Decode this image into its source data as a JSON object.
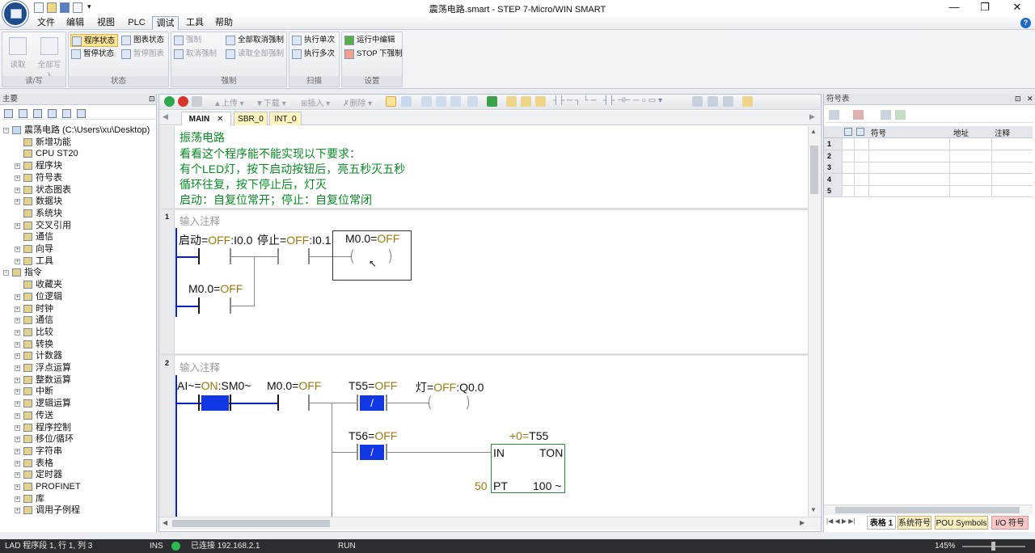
{
  "window": {
    "title": "震荡电路.smart - STEP 7-Micro/WIN SMART"
  },
  "menu": [
    "文件",
    "编辑",
    "视图",
    "PLC",
    "调试",
    "工具",
    "帮助"
  ],
  "ribbon": {
    "groups": [
      {
        "label": "读/写",
        "buttons": [
          "读取",
          "全部写入"
        ]
      },
      {
        "label": "状态",
        "buttons": [
          "程序状态",
          "暂停状态",
          "图表状态",
          "暂停图表"
        ]
      },
      {
        "label": "强制",
        "buttons": [
          "强制",
          "取消强制",
          "全部取消强制",
          "读取全部强制"
        ]
      },
      {
        "label": "扫描",
        "buttons": [
          "执行单次",
          "执行多次"
        ]
      },
      {
        "label": "设置",
        "buttons": [
          "运行中编辑",
          "STOP 下强制"
        ]
      }
    ]
  },
  "left_panel": {
    "title": "主要",
    "tree": [
      {
        "label": "震荡电路 (C:\\Users\\xu\\Desktop)",
        "level": 0,
        "exp": "minus"
      },
      {
        "label": "新增功能",
        "level": 1,
        "exp": ""
      },
      {
        "label": "CPU ST20",
        "level": 1,
        "exp": ""
      },
      {
        "label": "程序块",
        "level": 1,
        "exp": "plus"
      },
      {
        "label": "符号表",
        "level": 1,
        "exp": "plus"
      },
      {
        "label": "状态图表",
        "level": 1,
        "exp": "plus"
      },
      {
        "label": "数据块",
        "level": 1,
        "exp": "plus"
      },
      {
        "label": "系统块",
        "level": 1,
        "exp": ""
      },
      {
        "label": "交叉引用",
        "level": 1,
        "exp": "plus"
      },
      {
        "label": "通信",
        "level": 1,
        "exp": ""
      },
      {
        "label": "向导",
        "level": 1,
        "exp": "plus"
      },
      {
        "label": "工具",
        "level": 1,
        "exp": "plus"
      },
      {
        "label": "指令",
        "level": 0,
        "exp": "minus"
      },
      {
        "label": "收藏夹",
        "level": 1,
        "exp": ""
      },
      {
        "label": "位逻辑",
        "level": 1,
        "exp": "plus"
      },
      {
        "label": "时钟",
        "level": 1,
        "exp": "plus"
      },
      {
        "label": "通信",
        "level": 1,
        "exp": "plus"
      },
      {
        "label": "比较",
        "level": 1,
        "exp": "plus"
      },
      {
        "label": "转换",
        "level": 1,
        "exp": "plus"
      },
      {
        "label": "计数器",
        "level": 1,
        "exp": "plus"
      },
      {
        "label": "浮点运算",
        "level": 1,
        "exp": "plus"
      },
      {
        "label": "整数运算",
        "level": 1,
        "exp": "plus"
      },
      {
        "label": "中断",
        "level": 1,
        "exp": "plus"
      },
      {
        "label": "逻辑运算",
        "level": 1,
        "exp": "plus"
      },
      {
        "label": "传送",
        "level": 1,
        "exp": "plus"
      },
      {
        "label": "程序控制",
        "level": 1,
        "exp": "plus"
      },
      {
        "label": "移位/循环",
        "level": 1,
        "exp": "plus"
      },
      {
        "label": "字符串",
        "level": 1,
        "exp": "plus"
      },
      {
        "label": "表格",
        "level": 1,
        "exp": "plus"
      },
      {
        "label": "定时器",
        "level": 1,
        "exp": "plus"
      },
      {
        "label": "PROFINET",
        "level": 1,
        "exp": "plus"
      },
      {
        "label": "库",
        "level": 1,
        "exp": "plus"
      },
      {
        "label": "调用子例程",
        "level": 1,
        "exp": "plus"
      }
    ]
  },
  "editor": {
    "toolbar": {
      "upload": "上传",
      "download": "下载",
      "insert": "插入",
      "delete": "删除"
    },
    "tabs": [
      "MAIN",
      "SBR_0",
      "INT_0"
    ],
    "program_comment": [
      "振荡电路",
      "看看这个程序能不能实现以下要求：",
      "有个LED灯，按下启动按钮后，亮五秒灭五秒",
      "循环往复，按下停止后，灯灭",
      "启动：自复位常开；停止：自复位常闭"
    ],
    "network1": {
      "number": "1",
      "comment": "输入注释",
      "contact1": {
        "name": "启动=",
        "state": "OFF",
        "addr": ":I0.0"
      },
      "contact2": {
        "name": "停止=",
        "state": "OFF",
        "addr": ":I0.1"
      },
      "coil": {
        "name": "M0.0=",
        "state": "OFF"
      },
      "branch": {
        "name": "M0.0=",
        "state": "OFF"
      }
    },
    "network2": {
      "number": "2",
      "comment": "输入注释",
      "contact1": {
        "name": "AI~=",
        "state": "ON",
        "addr": ":SM0~"
      },
      "contact2": {
        "name": "M0.0=",
        "state": "OFF"
      },
      "contact3": {
        "name": "T55=",
        "state": "OFF"
      },
      "coil": {
        "name": "灯=",
        "state": "OFF",
        "addr": ":Q0.0"
      },
      "contact4": {
        "name": "T56=",
        "state": "OFF"
      },
      "timer": {
        "name": "T55",
        "value_prefix": "+0=",
        "type": "TON",
        "in": "IN",
        "pt": "PT",
        "pt_value": "50",
        "resolution": "100 ~"
      }
    }
  },
  "right_panel": {
    "title": "符号表",
    "columns": [
      "符号",
      "地址",
      "注释"
    ],
    "rows": [
      "1",
      "2",
      "3",
      "4",
      "5"
    ],
    "tabs": [
      "表格 1",
      "系统符号",
      "POU Symbols",
      "I/O 符号"
    ]
  },
  "status": {
    "position": "LAD 程序段 1, 行 1, 列 3",
    "mode": "INS",
    "connection": "已连接 192.168.2.1",
    "run": "RUN",
    "zoom": "145%"
  }
}
